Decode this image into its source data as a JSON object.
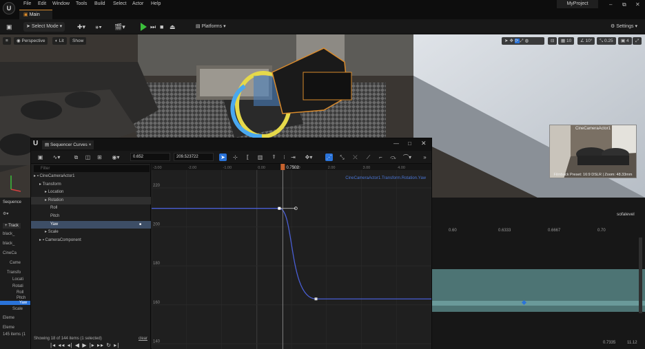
{
  "app": {
    "menu": [
      "File",
      "Edit",
      "Window",
      "Tools",
      "Build",
      "Select",
      "Actor",
      "Help"
    ],
    "tab": "Main",
    "project": "MyProject",
    "window_buttons": [
      "–",
      "⧉",
      "✕"
    ]
  },
  "toolbar": {
    "select_mode": "Select Mode",
    "platforms": "Platforms",
    "settings": "Settings"
  },
  "viewport": {
    "menu_label": "≡",
    "perspective": "Perspective",
    "lit": "Lit",
    "show": "Show",
    "grid_snap": "10",
    "angle_snap": "10°",
    "scale_snap": "0.25",
    "cam_speed": "4",
    "pip_title": "CineCameraActor1",
    "pip_caption": "Filmback Preset: 16:9 DSLR | Zoom: 48.33mm"
  },
  "bg_sequencer": {
    "tab": "Sequence",
    "track_btn": "+ Track",
    "rows": [
      "black_",
      "black_",
      "CineCa",
      "Came",
      "Transfo",
      "Locati",
      "Rotati",
      "Roll",
      "Pitch",
      "Yaw",
      "Scale",
      "Eleme",
      "Eleme"
    ],
    "items": "145 items (1",
    "level": "sofalevel",
    "ruler": [
      "0.60",
      "0.6333",
      "0.6667",
      "0.70"
    ],
    "time_a": "0.7335",
    "time_b": "11.12"
  },
  "curves_window": {
    "tab": "Sequencer Curves",
    "time_value": "0.652",
    "value_value": "209.523722",
    "filter_placeholder": "Filter",
    "tree": [
      {
        "label": "CineCameraActor1",
        "depth": 0,
        "icon": "camera-icon",
        "state": "normal"
      },
      {
        "label": "Transform",
        "depth": 1,
        "icon": "",
        "state": "normal"
      },
      {
        "label": "Location",
        "depth": 2,
        "icon": "",
        "state": "normal"
      },
      {
        "label": "Rotation",
        "depth": 2,
        "icon": "",
        "state": "highlight"
      },
      {
        "label": "Roll",
        "depth": 3,
        "icon": "",
        "state": "normal"
      },
      {
        "label": "Pitch",
        "depth": 3,
        "icon": "",
        "state": "normal"
      },
      {
        "label": "Yaw",
        "depth": 3,
        "icon": "",
        "state": "selected"
      },
      {
        "label": "Scale",
        "depth": 2,
        "icon": "",
        "state": "normal"
      },
      {
        "label": "CameraComponent",
        "depth": 1,
        "icon": "camera-icon",
        "state": "normal"
      }
    ],
    "status": "Showing 18 of 144 items (1 selected)",
    "clear": "clear",
    "graph": {
      "track_label": "CineCameraActor1.Transform.Rotation.Yaw",
      "playhead": "0.7502",
      "x_ticks": [
        "-3.00",
        "-2.00",
        "-1.00",
        "0.00",
        "1.00",
        "2.00",
        "3.00",
        "4.00",
        "5.00"
      ],
      "y_ticks": [
        "220",
        "200",
        "180",
        "160",
        "140"
      ],
      "curve": {
        "start_value": 209.5,
        "end_value": 163,
        "key1_time": 0.652,
        "key2_time": 1.7
      }
    }
  }
}
